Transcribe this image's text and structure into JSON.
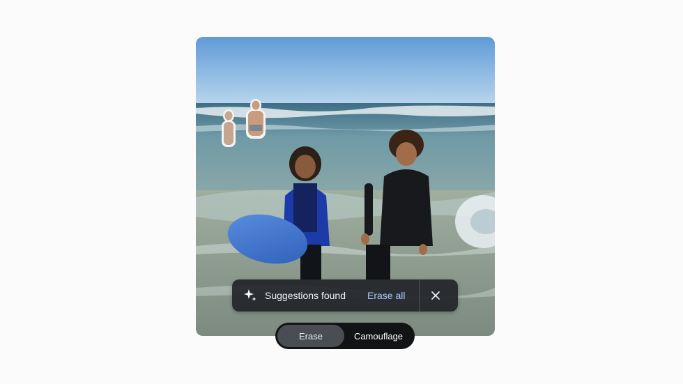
{
  "toast": {
    "message": "Suggestions found",
    "action_label": "Erase all",
    "icon": "sparkle-icon",
    "close_icon": "close-icon"
  },
  "mode_switch": {
    "options": [
      {
        "label": "Erase",
        "selected": true
      },
      {
        "label": "Camouflage",
        "selected": false
      }
    ]
  },
  "colors": {
    "accent": "#a8c7fa",
    "toast_bg": "#222428",
    "segment_bg": "#121314",
    "segment_active": "#4a4d52"
  }
}
